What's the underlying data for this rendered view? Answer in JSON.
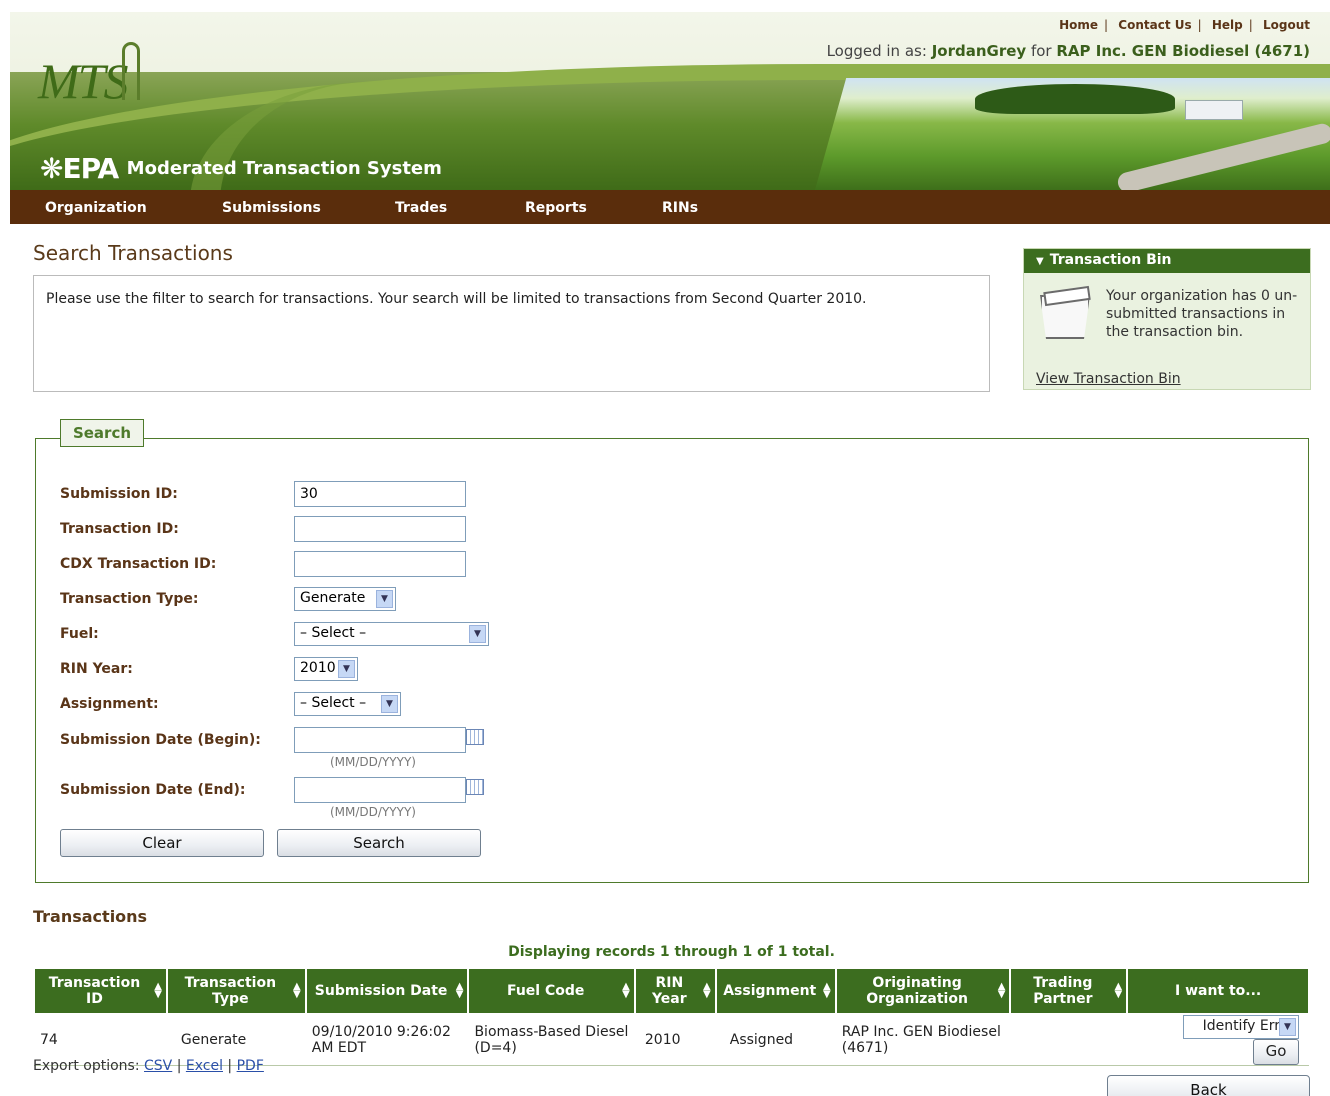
{
  "header": {
    "logo_text": "MTS",
    "epa_mark": "EPA",
    "system_name": "Moderated Transaction System",
    "top_links": [
      "Home",
      "Contact Us",
      "Help",
      "Logout"
    ],
    "logged_in_prefix": "Logged in as:",
    "user": "JordanGrey",
    "for_word": "for",
    "organization": "RAP Inc. GEN Biodiesel (4671)"
  },
  "nav": {
    "items": [
      "Organization",
      "Submissions",
      "Trades",
      "Reports",
      "RINs"
    ]
  },
  "page": {
    "title": "Search Transactions",
    "info": "Please use the filter to search for transactions. Your search will be limited to transactions from Second Quarter 2010."
  },
  "transaction_bin": {
    "title": "Transaction Bin",
    "message": "Your organization has 0 un-submitted transactions in the transaction bin.",
    "link": "View Transaction Bin"
  },
  "search": {
    "legend": "Search",
    "fields": {
      "submission_id": {
        "label": "Submission ID:",
        "value": "30"
      },
      "transaction_id": {
        "label": "Transaction ID:",
        "value": ""
      },
      "cdx_transaction_id": {
        "label": "CDX Transaction ID:",
        "value": ""
      },
      "transaction_type": {
        "label": "Transaction Type:",
        "value": "Generate"
      },
      "fuel": {
        "label": "Fuel:",
        "value": "– Select –"
      },
      "rin_year": {
        "label": "RIN Year:",
        "value": "2010"
      },
      "assignment": {
        "label": "Assignment:",
        "value": "– Select –"
      },
      "date_begin": {
        "label": "Submission Date (Begin):",
        "value": "",
        "hint": "(MM/DD/YYYY)"
      },
      "date_end": {
        "label": "Submission Date (End):",
        "value": "",
        "hint": "(MM/DD/YYYY)"
      }
    },
    "clear_label": "Clear",
    "search_label": "Search"
  },
  "transactions": {
    "title": "Transactions",
    "count_text": "Displaying records 1 through 1 of 1 total.",
    "columns": [
      "Transaction ID",
      "Transaction Type",
      "Submission Date",
      "Fuel Code",
      "RIN Year",
      "Assignment",
      "Originating Organization",
      "Trading Partner",
      "I want to..."
    ],
    "rows": [
      {
        "transaction_id": "74",
        "type": "Generate",
        "submission_date": "09/10/2010 9:26:02 AM EDT",
        "fuel_code": "Biomass-Based Diesel (D=4)",
        "rin_year": "2010",
        "assignment": "Assigned",
        "originating_org": "RAP Inc. GEN Biodiesel (4671)",
        "trading_partner": "",
        "action": "Identify Error",
        "go": "Go"
      }
    ],
    "export_label": "Export options:",
    "export_links": [
      "CSV",
      "Excel",
      "PDF"
    ],
    "back_label": "Back"
  },
  "colors": {
    "nav_bg": "#5a2d0c",
    "header_green": "#3c6d1f",
    "label_brown": "#5a3518",
    "frame_green": "#4e7a2b"
  }
}
